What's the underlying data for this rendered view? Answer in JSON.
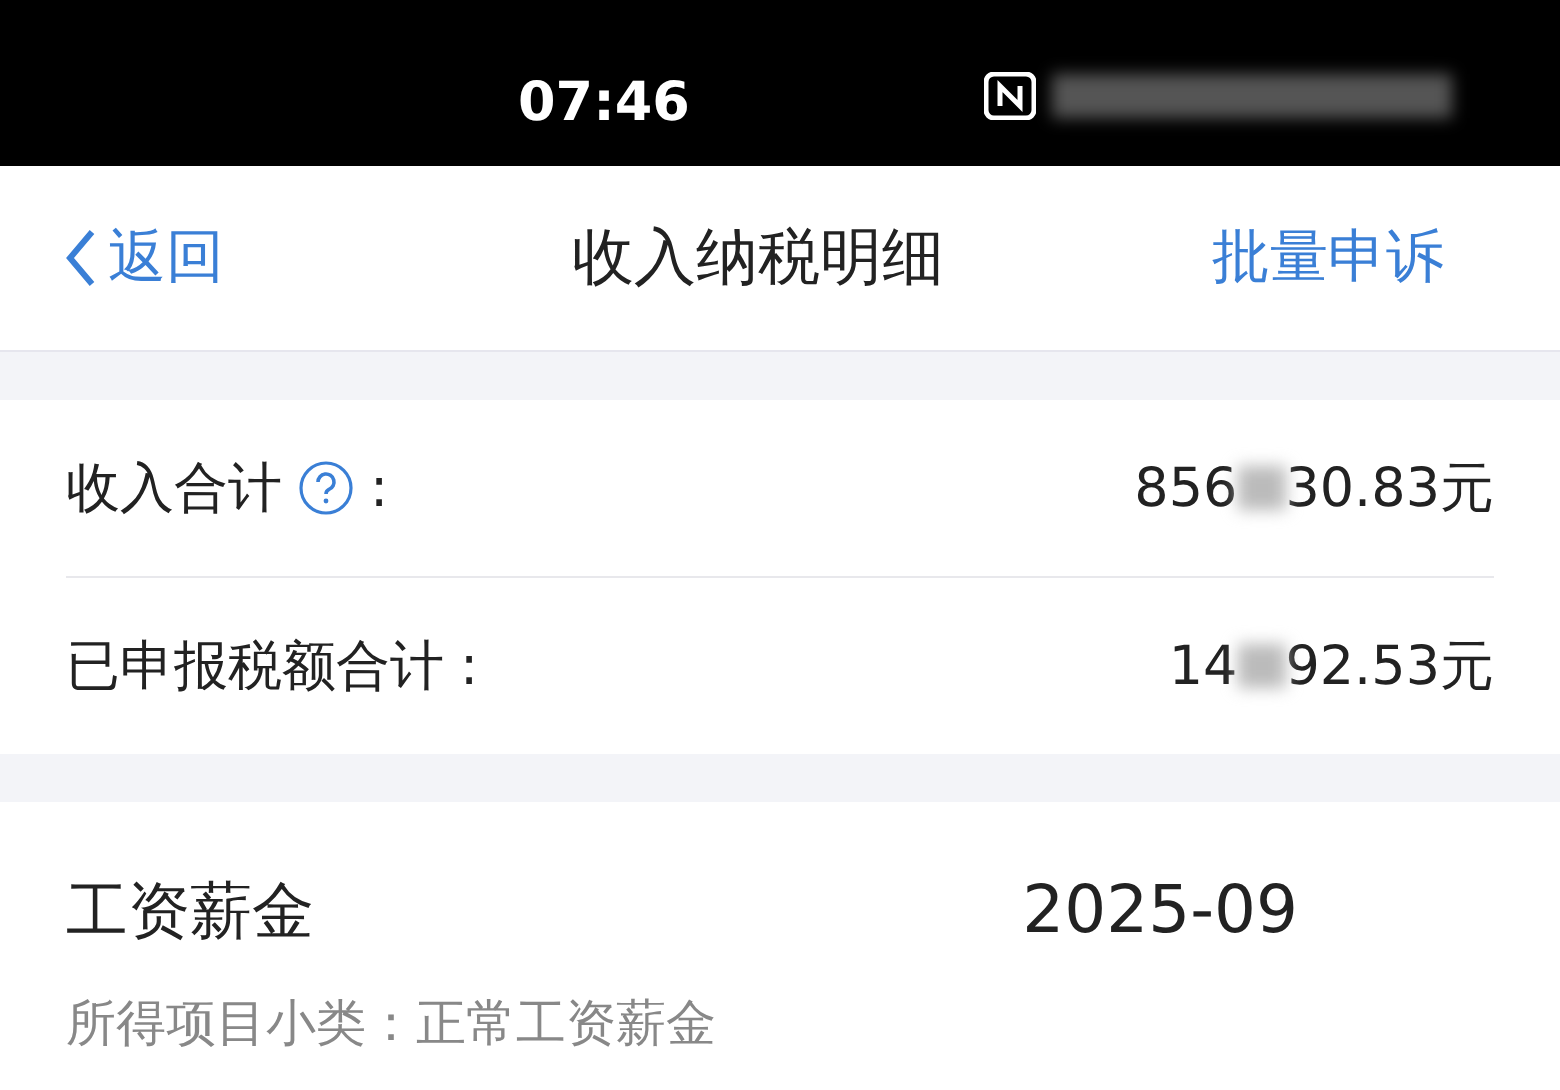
{
  "status_bar": {
    "time": "07:46"
  },
  "nav": {
    "back": "返回",
    "title": "收入纳税明细",
    "action": "批量申诉"
  },
  "summary": [
    {
      "label": "收入合计",
      "help": true,
      "colon": ":",
      "value_head": "856",
      "value_tail": "30.83元"
    },
    {
      "label": "已申报税额合计",
      "help": false,
      "colon": ":",
      "value_head": "14",
      "value_tail": "92.53元"
    }
  ],
  "records": [
    {
      "title": "工资薪金",
      "period": "2025-09",
      "subtitle": "所得项目小类：正常工资薪金"
    }
  ]
}
